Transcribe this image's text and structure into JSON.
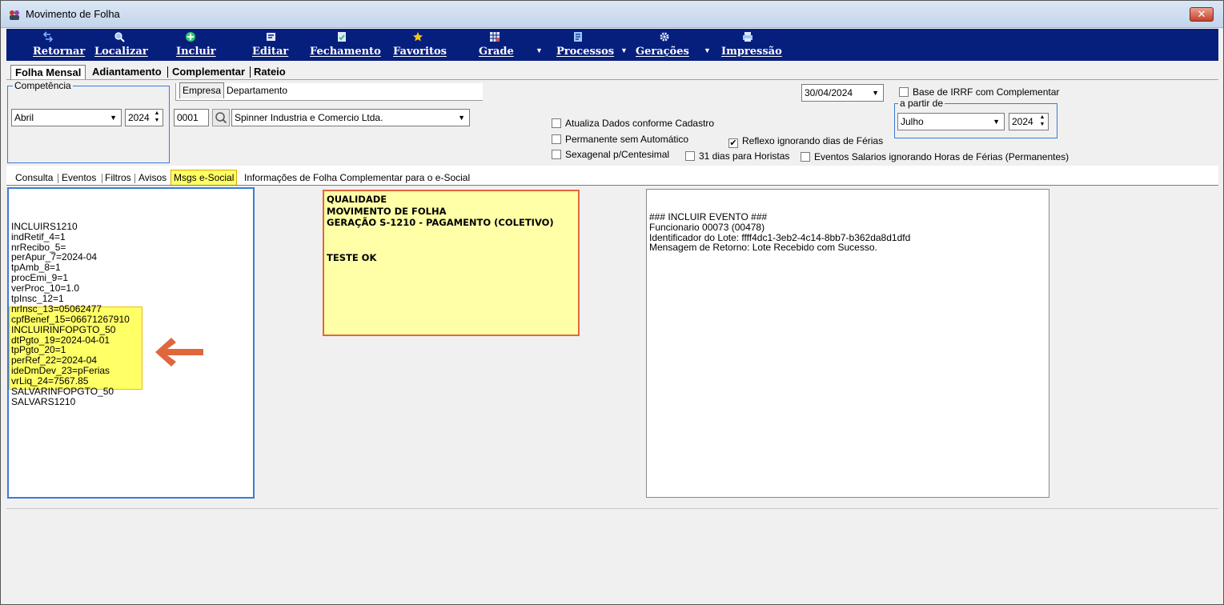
{
  "window": {
    "title": "Movimento de Folha",
    "close_label": "✕"
  },
  "toolbar": {
    "buttons": [
      {
        "label": "Retornar",
        "icon": "return-arrow-icon"
      },
      {
        "label": "Localizar",
        "icon": "search-icon"
      },
      {
        "label": "Incluir",
        "icon": "add-icon"
      },
      {
        "label": "Editar",
        "icon": "edit-icon"
      },
      {
        "label": "Fechamento",
        "icon": "document-check-icon"
      },
      {
        "label": "Favoritos",
        "icon": "star-icon"
      },
      {
        "label": "Grade",
        "icon": "grid-icon"
      },
      {
        "label": "Processos",
        "icon": "process-icon"
      },
      {
        "label": "Gerações",
        "icon": "gear-icon"
      },
      {
        "label": "Impressão",
        "icon": "printer-icon"
      }
    ],
    "background": "#071f7c"
  },
  "main_tabs": [
    "Folha Mensal",
    "Adiantamento",
    "Complementar",
    "Rateio"
  ],
  "competencia": {
    "legend": "Competência",
    "month": "Abril",
    "year": "2024"
  },
  "empresa_tabs": [
    "Empresa",
    "Departamento"
  ],
  "empresa": {
    "code": "0001",
    "name": "Spinner Industria e Comercio Ltda."
  },
  "date_select": "30/04/2024",
  "base_irrf": {
    "label": "Base de IRRF com Complementar",
    "checked": false,
    "legend": "a partir de",
    "month": "Julho",
    "year": "2024"
  },
  "options": {
    "atualiza": {
      "label": "Atualiza Dados conforme Cadastro",
      "checked": false
    },
    "permanente": {
      "label": "Permanente sem Automático",
      "checked": false
    },
    "sexagenal": {
      "label": "Sexagenal p/Centesimal",
      "checked": false
    },
    "reflexo": {
      "label": "Reflexo ignorando dias de Férias",
      "checked": true
    },
    "dias31": {
      "label": "31 dias para Horistas",
      "checked": false
    },
    "eventos_salarios": {
      "label": "Eventos Salarios ignorando Horas de Férias (Permanentes)",
      "checked": false
    }
  },
  "lower_tabs": [
    "Consulta",
    "Eventos",
    "Filtros",
    "Avisos",
    "Msgs e-Social",
    "Informações de Folha Complementar para o e-Social"
  ],
  "lower_active": "Msgs e-Social",
  "left_memo": [
    "INCLUIRS1210",
    "indRetif_4=1",
    "nrRecibo_5=",
    "perApur_7=2024-04",
    "tpAmb_8=1",
    "procEmi_9=1",
    "verProc_10=1.0",
    "tpInsc_12=1",
    "nrInsc_13=05062477",
    "cpfBenef_15=06671267910",
    "INCLUIRINFOPGTO_50",
    "dtPgto_19=2024-04-01",
    "tpPgto_20=1",
    "perRef_22=2024-04",
    "ideDmDev_23=pFerias",
    "vrLiq_24=7567.85",
    "SALVARINFOPGTO_50",
    "SALVARS1210"
  ],
  "note": [
    "QUALIDADE",
    "MOVIMENTO DE FOLHA",
    "GERAÇÃO S-1210 - PAGAMENTO (COLETIVO)",
    "",
    "",
    "TESTE OK"
  ],
  "right_memo": [
    "### INCLUIR EVENTO ###",
    "Funcionario 00073 (00478)",
    "Identificador do Lote: ffff4dc1-3eb2-4c14-8bb7-b362da8d1dfd",
    "Mensagem de Retorno: Lote Recebido com Sucesso."
  ],
  "colors": {
    "highlight": "#ffff66",
    "annotation_arrow": "#e0663c",
    "focus_border": "#3b7bd6"
  }
}
